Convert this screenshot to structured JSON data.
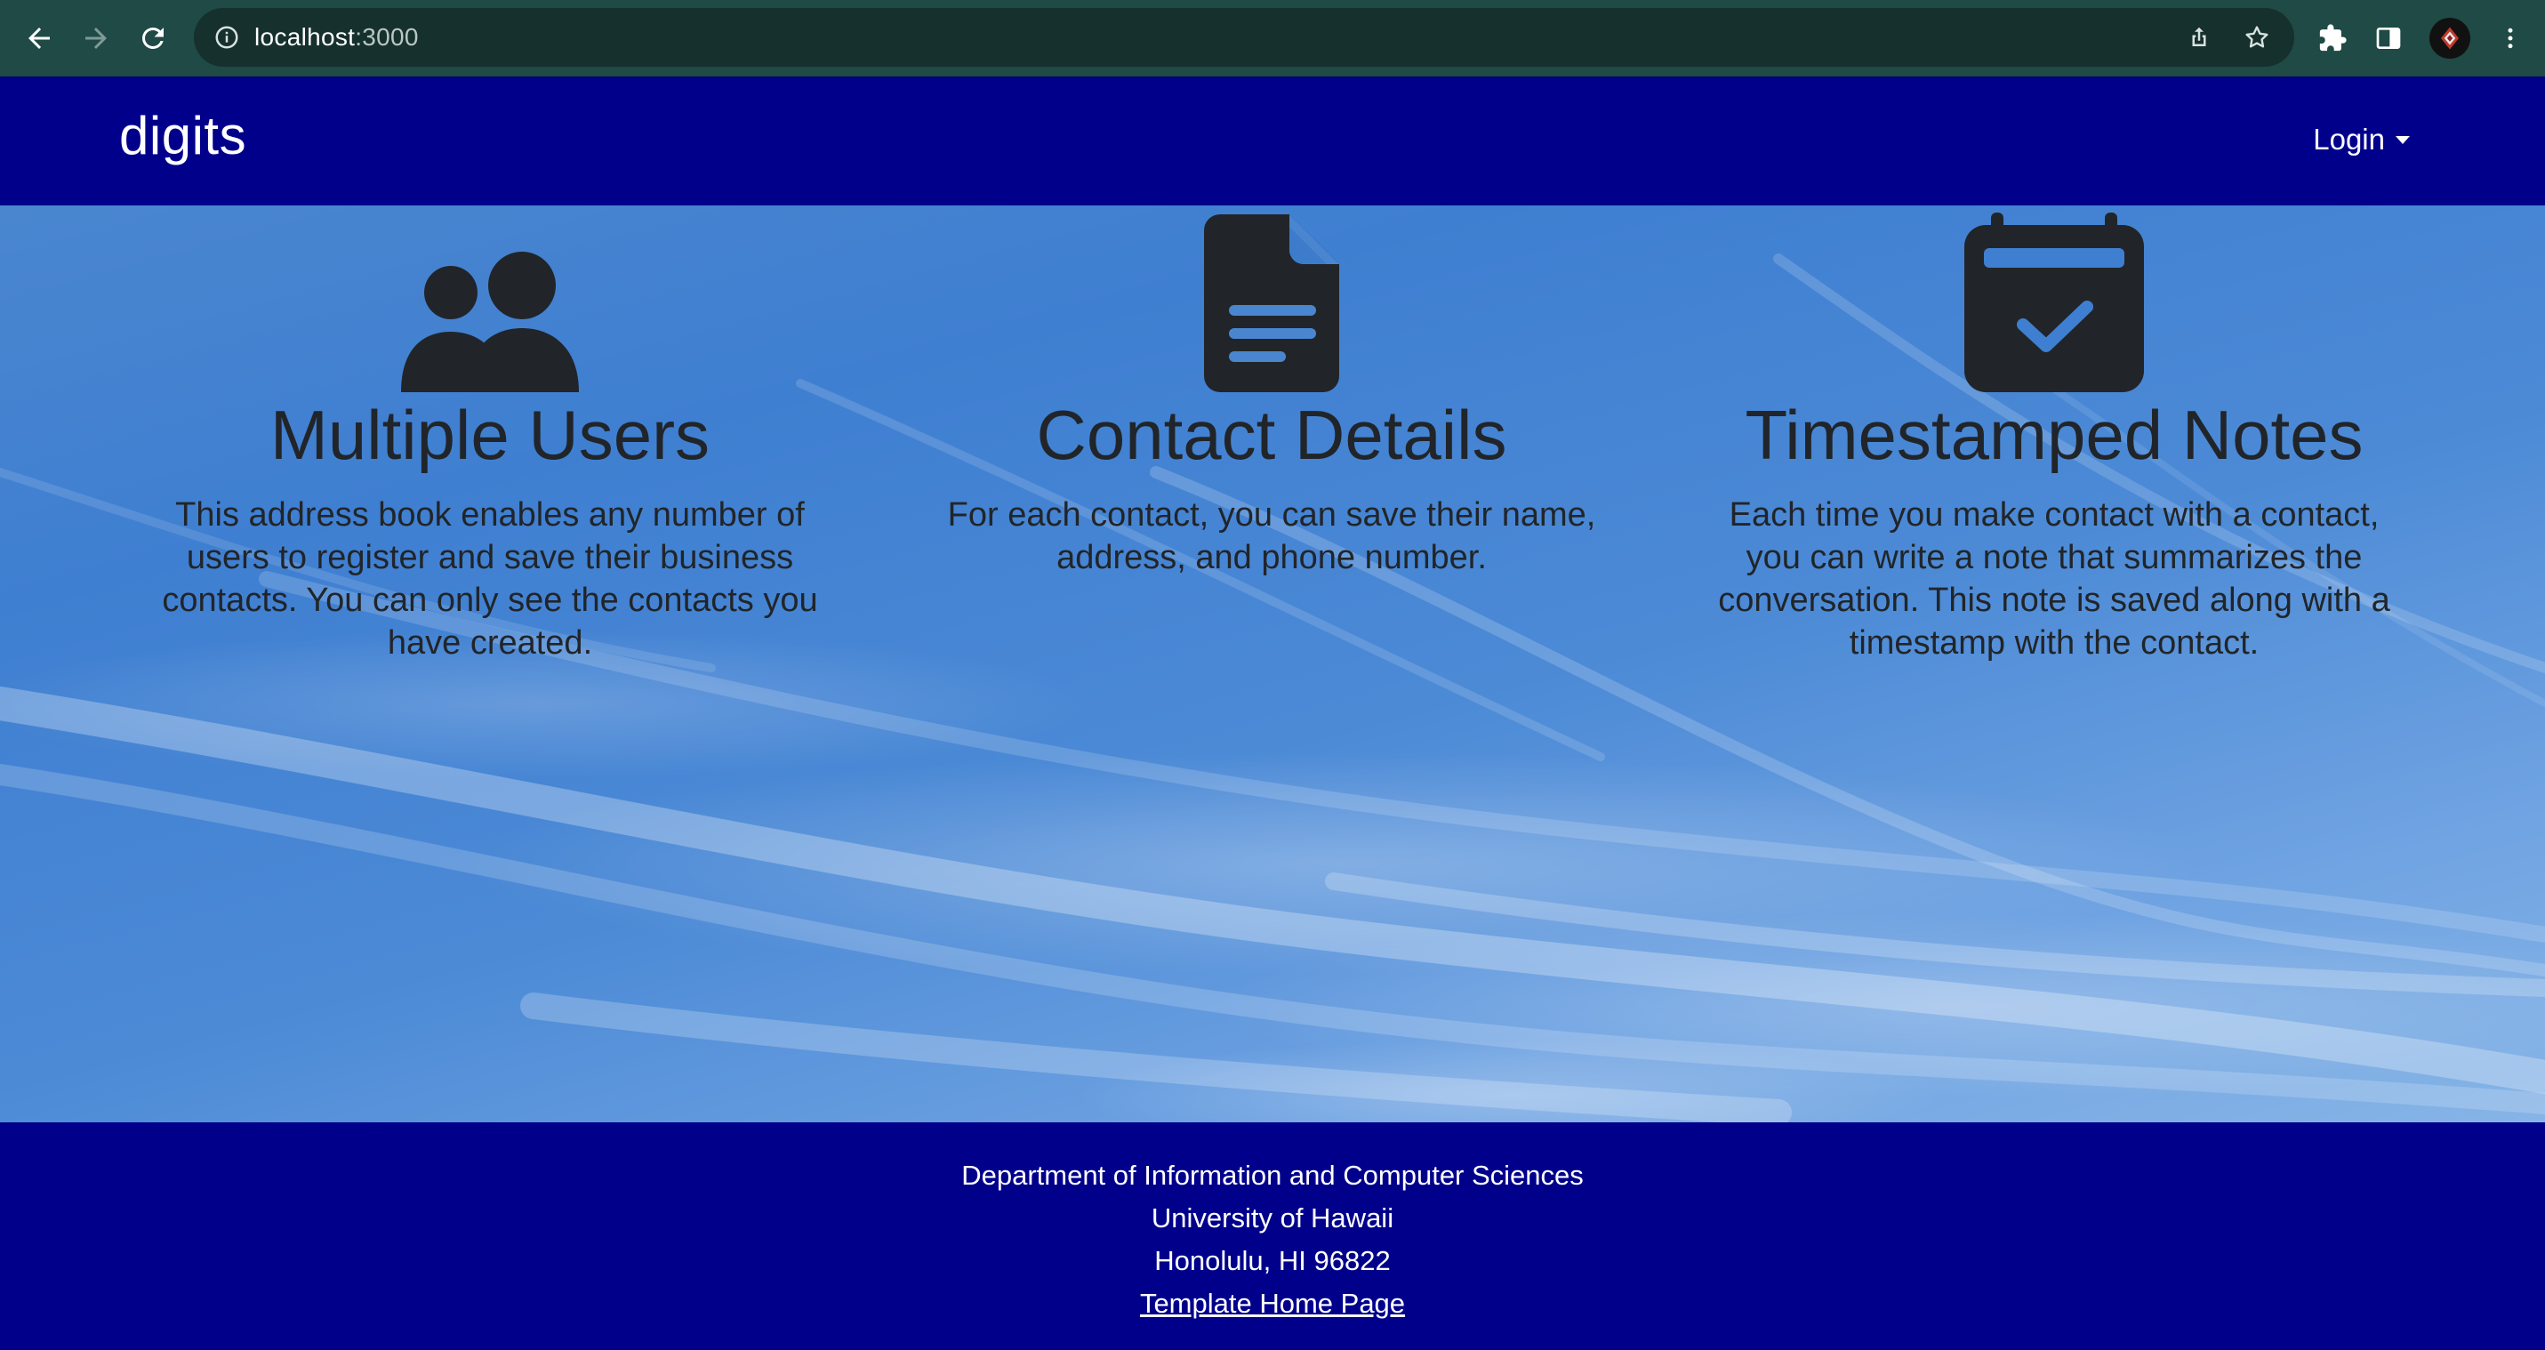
{
  "browser": {
    "url_host": "localhost",
    "url_port": ":3000"
  },
  "navbar": {
    "brand": "digits",
    "login_label": "Login"
  },
  "features": [
    {
      "title": "Multiple Users",
      "description": "This address book enables any number of users to register and save their business contacts. You can only see the contacts you have created.",
      "icon": "users-icon"
    },
    {
      "title": "Contact Details",
      "description": "For each contact, you can save their name, address, and phone number.",
      "icon": "file-text-icon"
    },
    {
      "title": "Timestamped Notes",
      "description": "Each time you make contact with a contact, you can write a note that summarizes the conversation. This note is saved along with a timestamp with the contact.",
      "icon": "calendar-check-icon"
    }
  ],
  "footer": {
    "line1": "Department of Information and Computer Sciences",
    "line2": "University of Hawaii",
    "line3": "Honolulu, HI 96822",
    "link": "Template Home Page"
  },
  "colors": {
    "navbar_bg": "#00008b",
    "chrome_bg": "#1f4a45",
    "text_dark": "#212529"
  }
}
